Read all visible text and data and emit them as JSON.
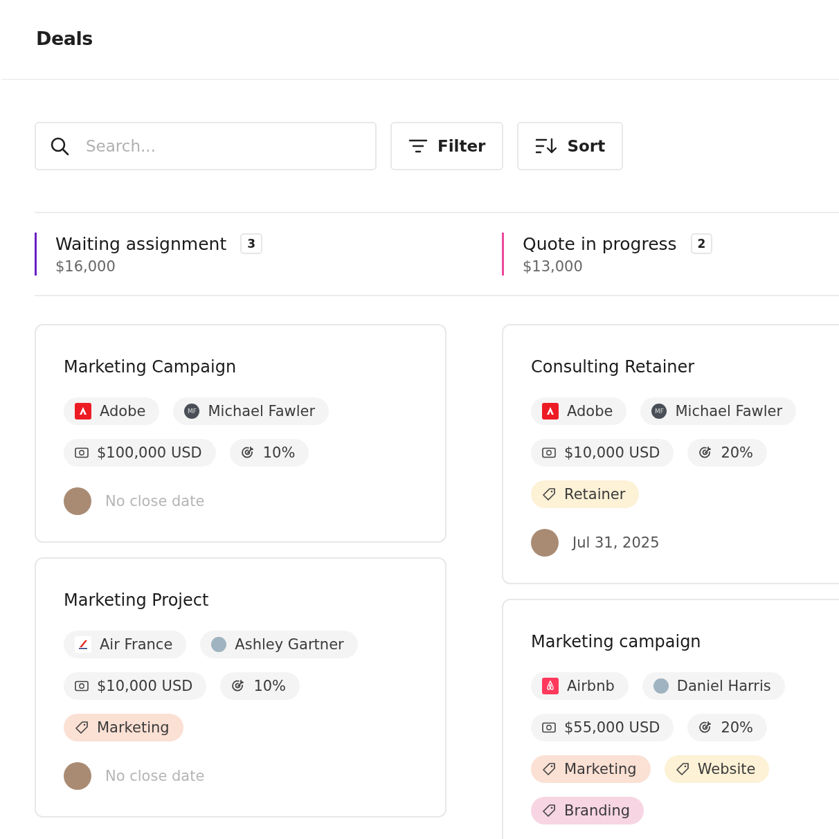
{
  "page": {
    "title": "Deals"
  },
  "toolbar": {
    "search": {
      "placeholder": "Search..."
    },
    "buttons": [
      {
        "kind": "filter",
        "label": "Filter"
      },
      {
        "kind": "sort",
        "label": "Sort"
      }
    ]
  },
  "columns": [
    {
      "title": "Waiting assignment",
      "count": "3",
      "total": "$16,000",
      "color": "#6a1fc4",
      "cards": [
        {
          "title": "Marketing Campaign",
          "company": {
            "kind": "adobe",
            "name": "Adobe"
          },
          "owner": {
            "name": "Michael Fawler",
            "initials": "MF"
          },
          "amount": "$100,000 USD",
          "probability": "10%",
          "close_date": "No close date",
          "has_date": false
        },
        {
          "title": "Marketing Project",
          "company": {
            "kind": "air-france",
            "name": "Air France"
          },
          "owner": {
            "name": "Ashley Gartner"
          },
          "amount": "$10,000 USD",
          "probability": "10%",
          "tags": [
            {
              "label": "Marketing",
              "color": "#fbe0d4"
            }
          ],
          "close_date": "No close date",
          "has_date": false
        }
      ]
    },
    {
      "title": "Quote in progress",
      "count": "2",
      "total": "$13,000",
      "color": "#ec4899",
      "cards": [
        {
          "title": "Consulting Retainer",
          "company": {
            "kind": "adobe",
            "name": "Adobe"
          },
          "owner": {
            "name": "Michael Fawler",
            "initials": "MF"
          },
          "amount": "$10,000 USD",
          "probability": "20%",
          "tags": [
            {
              "label": "Retainer",
              "color": "#fdf1d6"
            }
          ],
          "close_date": "Jul 31, 2025",
          "has_date": true
        },
        {
          "title": "Marketing campaign",
          "company": {
            "kind": "airbnb",
            "name": "Airbnb"
          },
          "owner": {
            "name": "Daniel Harris"
          },
          "amount": "$55,000 USD",
          "probability": "20%",
          "tags": [
            {
              "label": "Marketing",
              "color": "#fbe0d4"
            },
            {
              "label": "Website",
              "color": "#fdf1d6"
            },
            {
              "label": "Branding",
              "color": "#f7d5e3"
            }
          ]
        }
      ]
    }
  ]
}
